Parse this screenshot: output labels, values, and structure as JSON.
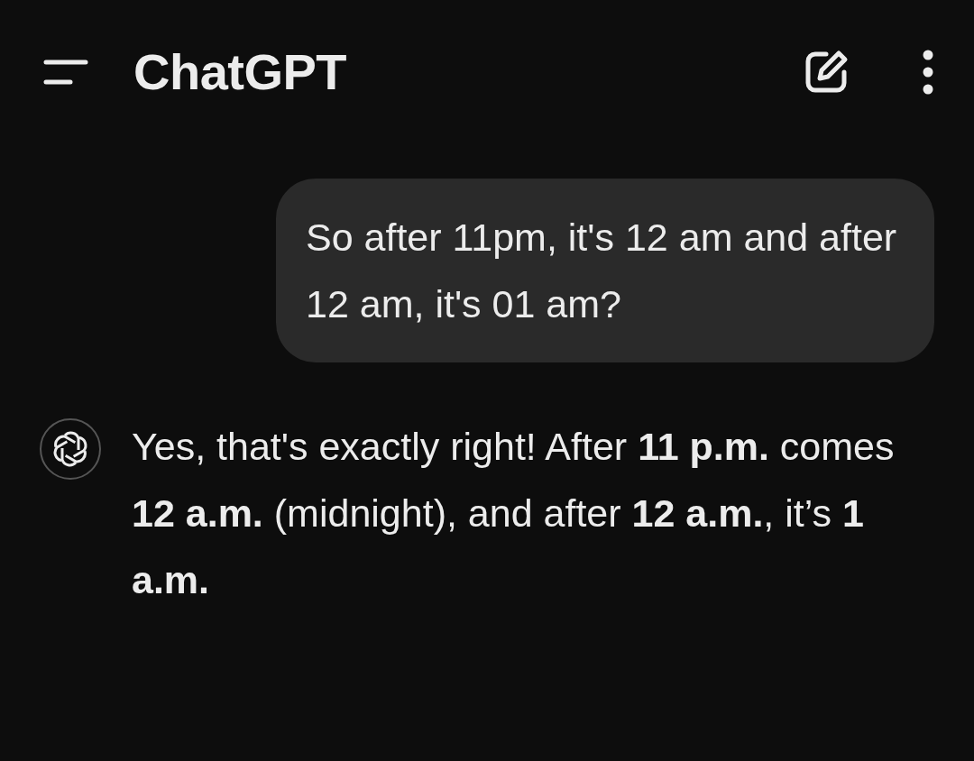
{
  "header": {
    "title": "ChatGPT"
  },
  "messages": [
    {
      "kind": "user",
      "text": "So after 11pm, it's 12 am and after 12 am, it's 01 am?"
    },
    {
      "kind": "assistant",
      "text": "Yes, that's exactly right! After **11 p.m.** comes **12 a.m.** (midnight), and after **12 a.m.**, it’s **1 a.m.**"
    }
  ]
}
